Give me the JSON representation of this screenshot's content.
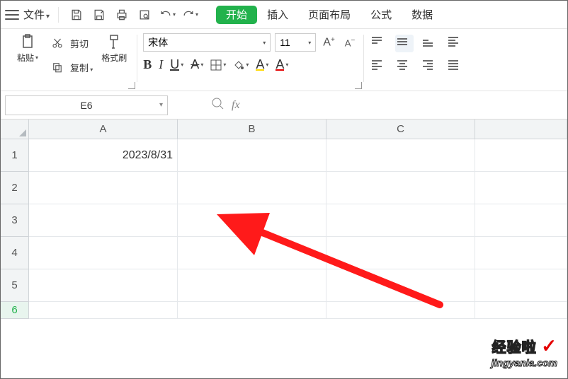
{
  "top": {
    "file_label": "文件",
    "tabs": [
      "开始",
      "插入",
      "页面布局",
      "公式",
      "数据"
    ]
  },
  "clipboard": {
    "paste": "粘贴",
    "cut": "剪切",
    "copy": "复制",
    "format_painter": "格式刷"
  },
  "font": {
    "name": "宋体",
    "size": "11",
    "increase": "A",
    "decrease": "A",
    "bold": "B",
    "italic": "I",
    "underline": "U",
    "strike_letter": "A",
    "font_a1": "A",
    "font_a2": "A"
  },
  "namebox": {
    "ref": "E6"
  },
  "formula": {
    "fx": "fx"
  },
  "sheet": {
    "columns": [
      "A",
      "B",
      "C"
    ],
    "rows": [
      "1",
      "2",
      "3",
      "4",
      "5",
      "6"
    ],
    "cells": {
      "A1": "2023/8/31"
    }
  },
  "watermark": {
    "line1": "经验啦",
    "check": "✓",
    "line2": "jingyanla.com"
  }
}
